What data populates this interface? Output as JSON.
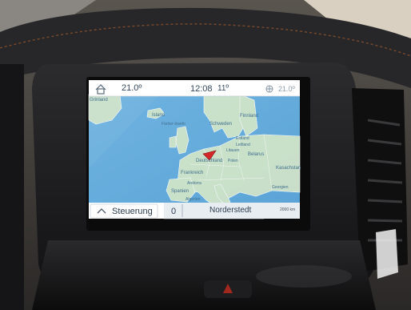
{
  "status_bar": {
    "outside_temp": "21.0º",
    "time": "12:08",
    "inside_temp": "11º",
    "right_temp": "21.0º"
  },
  "map": {
    "labels": [
      "Grinland",
      "Island",
      "Färöer-Inseln",
      "Schweden",
      "Finnland",
      "Estland",
      "Lettland",
      "Litauen",
      "Belarus",
      "Polen",
      "Deutschland",
      "Frankreich",
      "Spanien",
      "Andorra",
      "Kasachstan",
      "Georgien",
      "Algerien"
    ],
    "scale": "2000 km"
  },
  "bottom_bar": {
    "steering_label": "Steuerung",
    "speed": "0",
    "location": "Norderstedt"
  },
  "icons": [
    "home-icon",
    "chevron-up-icon",
    "fan-icon",
    "navigation-arrow-icon"
  ]
}
